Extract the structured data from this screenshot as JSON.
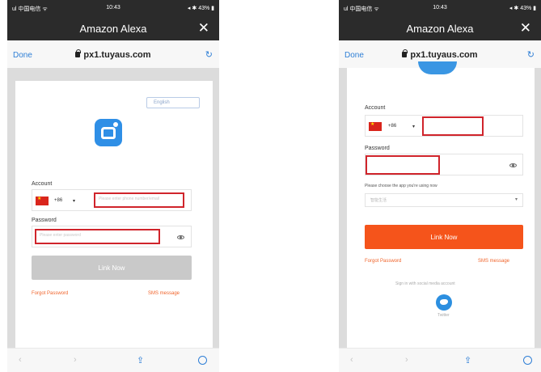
{
  "status_bar": {
    "carrier": "ul 中国电信 ᯤ",
    "time": "10:43",
    "battery": "◂ ✱ 43% ▮"
  },
  "nav": {
    "title": "Amazon Alexa",
    "close": "✕"
  },
  "address_bar": {
    "done": "Done",
    "url": "px1.tuyaus.com",
    "reload": "↻"
  },
  "left": {
    "language": "English",
    "account_label": "Account",
    "country_code": "+86",
    "account_placeholder": "Please enter phone number/email",
    "password_label": "Password",
    "password_placeholder": "Please enter password",
    "link_button": "Link Now",
    "forgot": "Forgot Password",
    "sms": "SMS message"
  },
  "right": {
    "account_label": "Account",
    "country_code": "+86",
    "password_label": "Password",
    "app_choose_label": "Please choose the app you're using now",
    "app_choose_value": "智能生活",
    "link_button": "Link Now",
    "forgot": "Forgot Password",
    "sms": "SMS message",
    "social_label": "Sign in with social media account",
    "twitter_label": "Twitter"
  },
  "bottom_bar": {
    "back": "‹",
    "forward": "›",
    "share": "⇪",
    "compass": ""
  },
  "colors": {
    "header": "#2b2b2b",
    "link_blue": "#2f7fd6",
    "brand_orange": "#f5541b",
    "highlight_red": "#d0242b",
    "disabled_button": "#c9c9c9"
  }
}
